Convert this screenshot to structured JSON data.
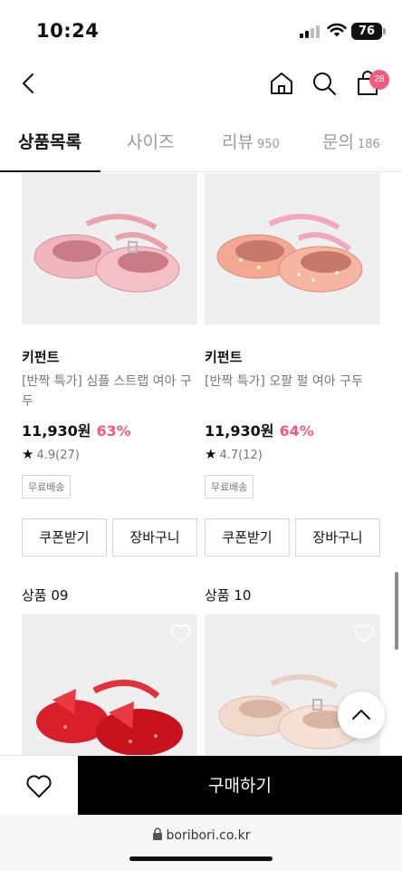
{
  "status_bar": {
    "time": "10:24",
    "battery": "76"
  },
  "header": {
    "cart_count": "28"
  },
  "tabs": [
    {
      "label": "상품목록",
      "count": ""
    },
    {
      "label": "사이즈",
      "count": ""
    },
    {
      "label": "리뷰",
      "count": "950"
    },
    {
      "label": "문의",
      "count": "186"
    }
  ],
  "products": [
    {
      "brand": "키펀트",
      "name": "[반짝 특가] 심플 스트랩 여아 구두",
      "price": "11,930원",
      "discount": "63%",
      "rating": "4.9(27)",
      "tag": "무료배송",
      "coupon_label": "쿠폰받기",
      "cart_label": "장바구니",
      "color": "#f0b6bf"
    },
    {
      "brand": "키펀트",
      "name": "[반짝 특가] 오팔 펄 여아 구두",
      "price": "11,930원",
      "discount": "64%",
      "rating": "4.7(12)",
      "tag": "무료배송",
      "coupon_label": "쿠폰받기",
      "cart_label": "장바구니",
      "color": "#f2a892"
    }
  ],
  "next_products": [
    {
      "label": "상품 09",
      "color": "#d81f2a"
    },
    {
      "label": "상품 10",
      "color": "#f1d9cc"
    }
  ],
  "bottom_bar": {
    "buy_label": "구매하기"
  },
  "url_bar": {
    "url": "boribori.co.kr"
  },
  "colors": {
    "accent": "#f25a7e",
    "buy_bg": "#000000"
  }
}
